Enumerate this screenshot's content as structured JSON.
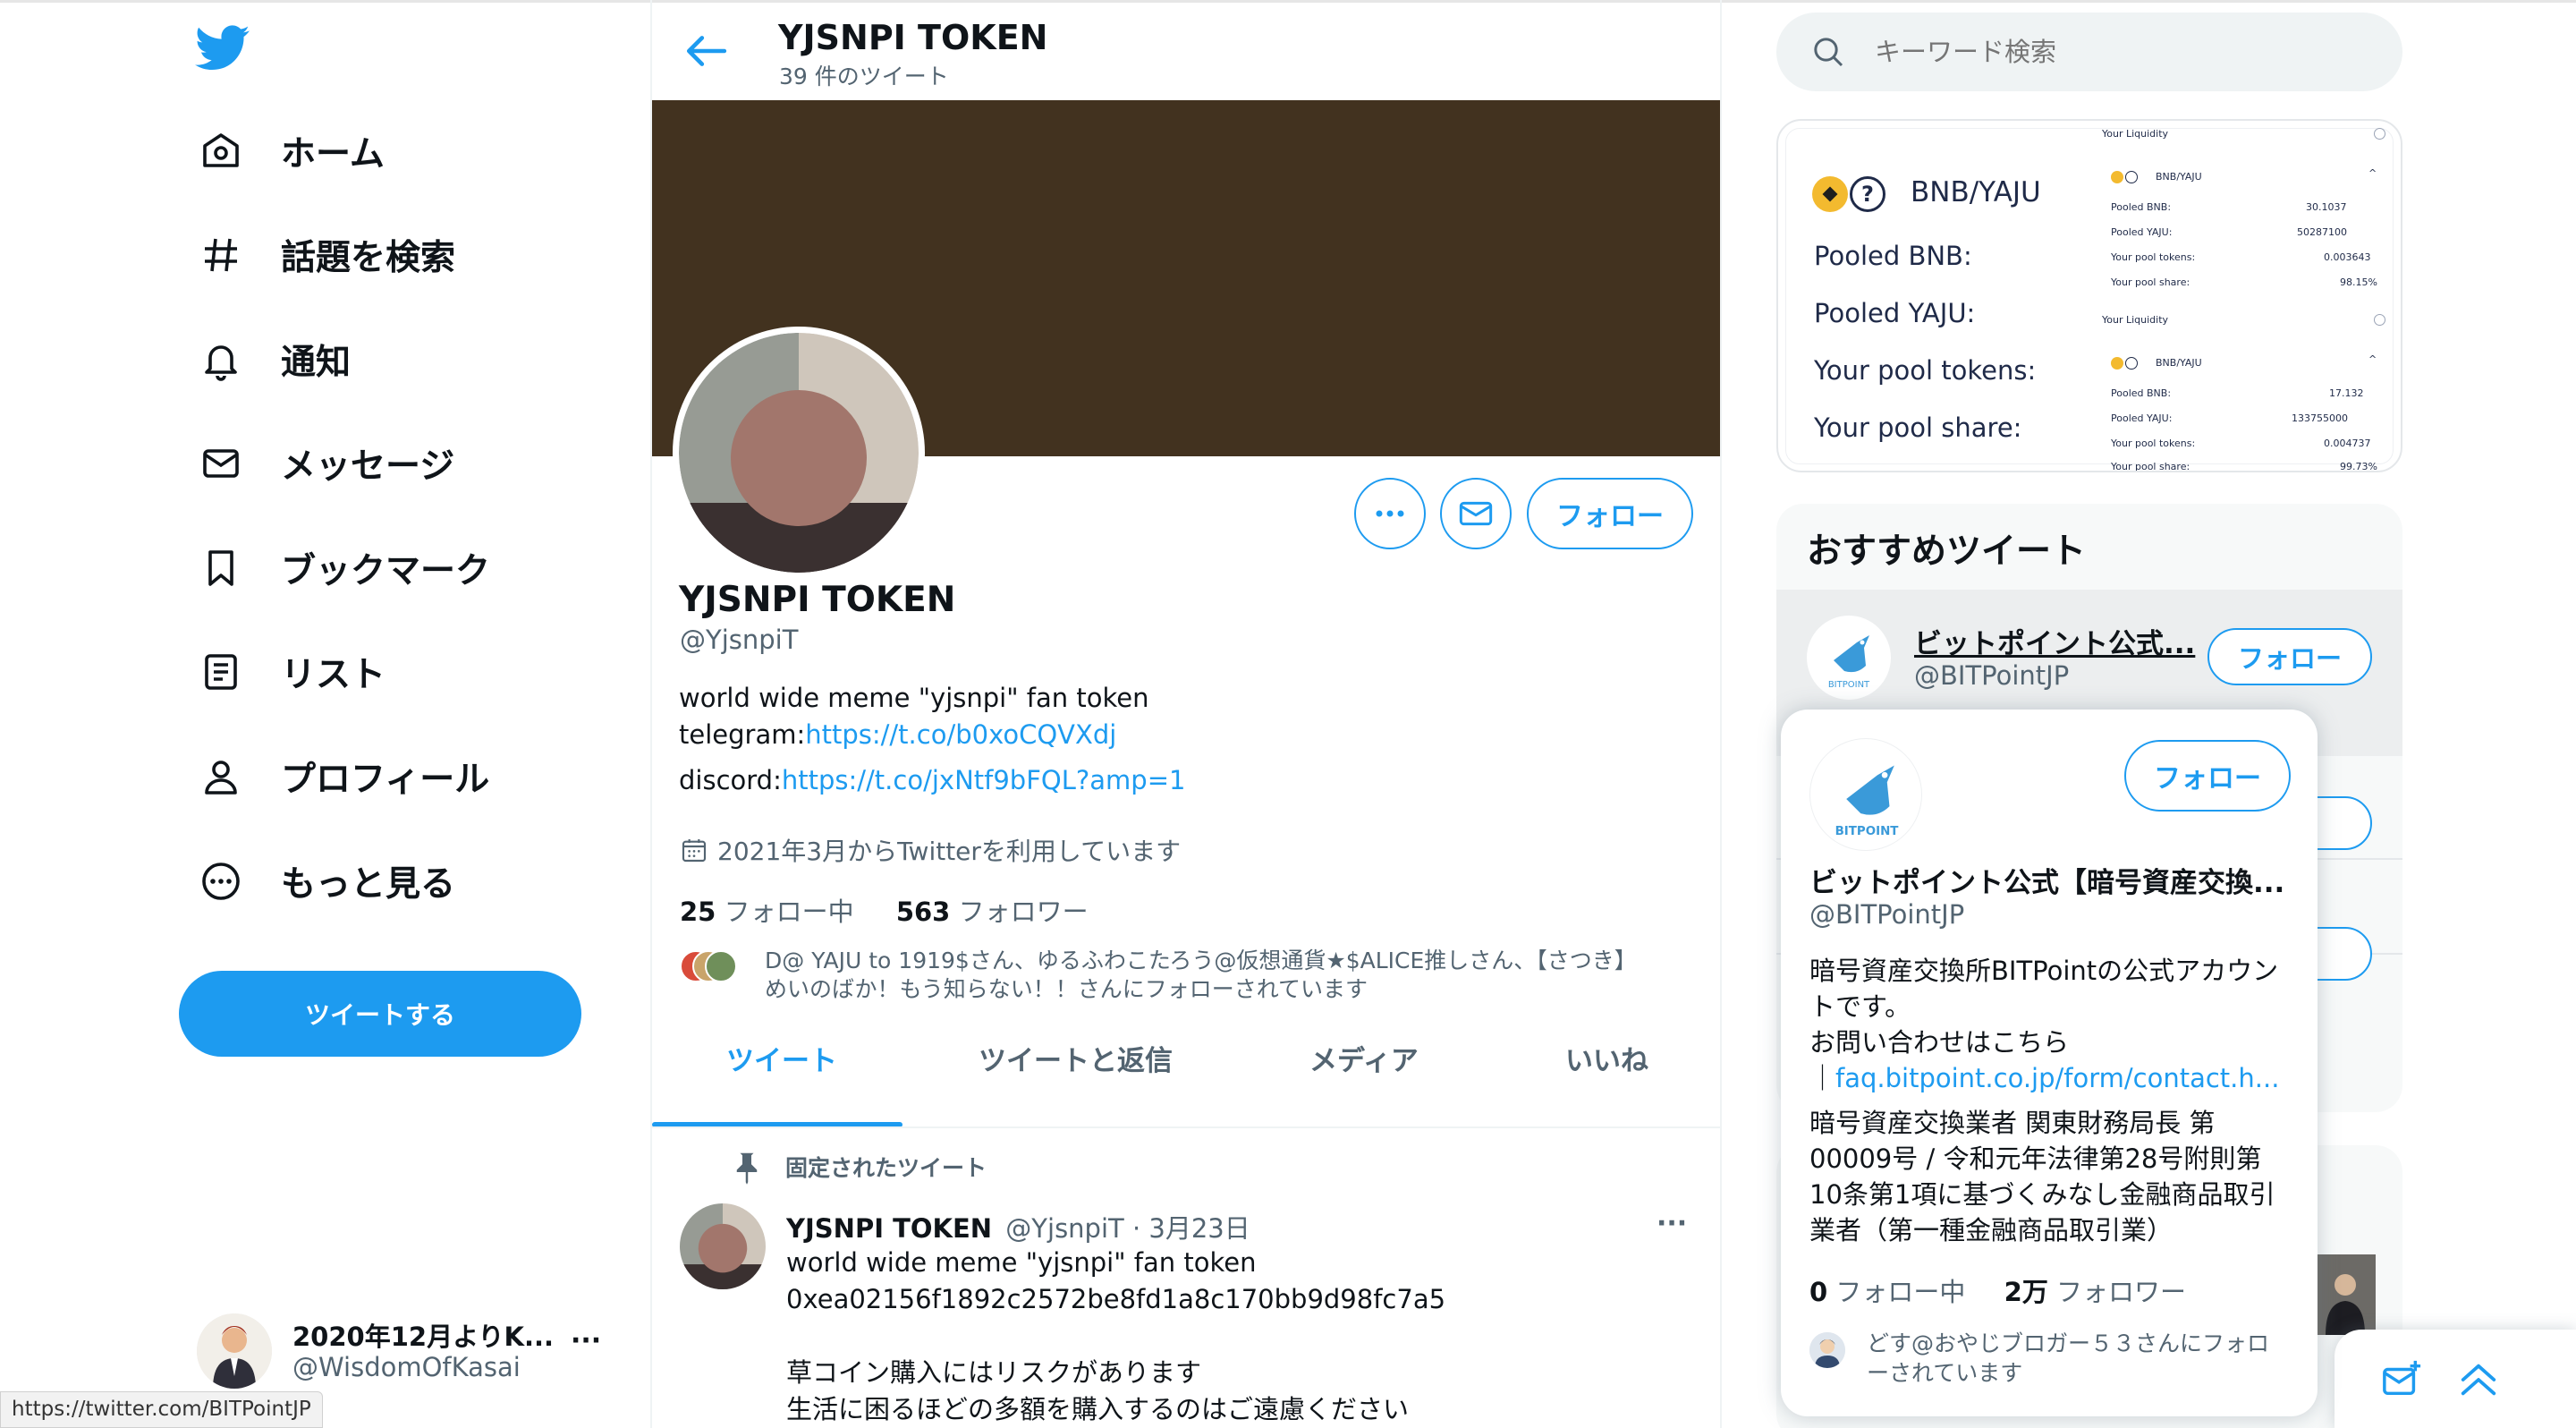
{
  "nav": {
    "items": [
      {
        "label": "ホーム",
        "icon": "home-icon"
      },
      {
        "label": "話題を検索",
        "icon": "hashtag-icon"
      },
      {
        "label": "通知",
        "icon": "bell-icon"
      },
      {
        "label": "メッセージ",
        "icon": "mail-icon"
      },
      {
        "label": "ブックマーク",
        "icon": "bookmark-icon"
      },
      {
        "label": "リスト",
        "icon": "list-icon"
      },
      {
        "label": "プロフィール",
        "icon": "person-icon"
      },
      {
        "label": "もっと見る",
        "icon": "more-circle-icon"
      }
    ],
    "tweet_button": "ツイートする",
    "account": {
      "name": "2020年12月よりK...",
      "handle": "@WisdomOfKasai"
    }
  },
  "status_url": "https://twitter.com/BITPointJP",
  "header": {
    "title": "YJSNPI TOKEN",
    "subtitle": "39 件のツイート"
  },
  "profile": {
    "follow_label": "フォロー",
    "name": "YJSNPI TOKEN",
    "handle": "@YjsnpiT",
    "bio_line1": "world wide meme \"yjsnpi\" fan token",
    "telegram_prefix": "telegram:",
    "telegram_link": "https://t.co/b0xoCQVXdj",
    "discord_prefix": "discord:",
    "discord_link": "https://t.co/jxNtf9bFQL?amp=1",
    "joined": "2021年3月からTwitterを利用しています",
    "following_count": "25",
    "following_label": "フォロー中",
    "followers_count": "563",
    "followers_label": "フォロワー",
    "followed_by_line1": "D@ YAJU to 1919$さん、ゆるふわこたろう@仮想通貨★$ALICE推しさん、【さつき】",
    "followed_by_line2": "めいのばか！もう知らない！！さんにフォローされています"
  },
  "tabs": [
    "ツイート",
    "ツイートと返信",
    "メディア",
    "いいね"
  ],
  "pinned": {
    "label": "固定されたツイート",
    "name": "YJSNPI TOKEN",
    "meta": "@YjsnpiT · 3月23日",
    "line1": "world wide meme \"yjsnpi\" fan token",
    "line2": "0xea02156f1892c2572be8fd1a8c170bb9d98fc7a5",
    "line3": "草コイン購入にはリスクがあります",
    "line4": "生活に困るほどの多額を購入するのはご遠慮ください"
  },
  "search": {
    "placeholder": "キーワード検索"
  },
  "liquidity": {
    "pair": "BNB/YAJU",
    "labels": [
      "Pooled BNB:",
      "Pooled YAJU:",
      "Your pool tokens:",
      "Your pool share:"
    ],
    "panel_title": "Your Liquidity",
    "panel_pair": "BNB/YAJU",
    "panel1": {
      "labels": [
        "Pooled BNB:",
        "Pooled YAJU:",
        "Your pool tokens:",
        "Your pool share:"
      ],
      "values": [
        "30.1037",
        "50287100",
        "0.003643",
        "98.15%"
      ]
    },
    "panel2": {
      "labels": [
        "Pooled BNB:",
        "Pooled YAJU:",
        "Your pool tokens:",
        "Your pool share:"
      ],
      "values": [
        "17.132",
        "133755000",
        "0.004737",
        "99.73%"
      ]
    }
  },
  "recommend": {
    "title": "おすすめツイート",
    "name": "ビットポイント公式...",
    "handle": "@BITPointJP",
    "follow_label": "フォロー"
  },
  "hover_card": {
    "follow_label": "フォロー",
    "name": "ビットポイント公式【暗号資産交換...",
    "handle": "@BITPointJP",
    "bio1": "暗号資産交換所BITPointの公式アカウン",
    "bio2": "トです。",
    "bio3": "お問い合わせはこちら",
    "bio4_prefix": "｜",
    "bio4_link": "faq.bitpoint.co.jp/form/contact.h...",
    "bio5": "暗号資産交換業者 関東財務局長 第",
    "bio6": "00009号 / 令和元年法律第28号附則第",
    "bio7": "10条第1項に基づくみなし金融商品取引",
    "bio8": "業者（第一種金融商品取引業）",
    "following_count": "0",
    "following_label": "フォロー中",
    "followers_count": "2万",
    "followers_label": "フォロワー",
    "followed_by_line1": "どす@おやじブロガー５３さんにフォロ",
    "followed_by_line2": "ーされています",
    "logo_text": "BITPOINT"
  },
  "colors": {
    "accent": "#1d9bf0",
    "banner": "#42321f",
    "text": "#0f1419",
    "muted": "#536471"
  }
}
